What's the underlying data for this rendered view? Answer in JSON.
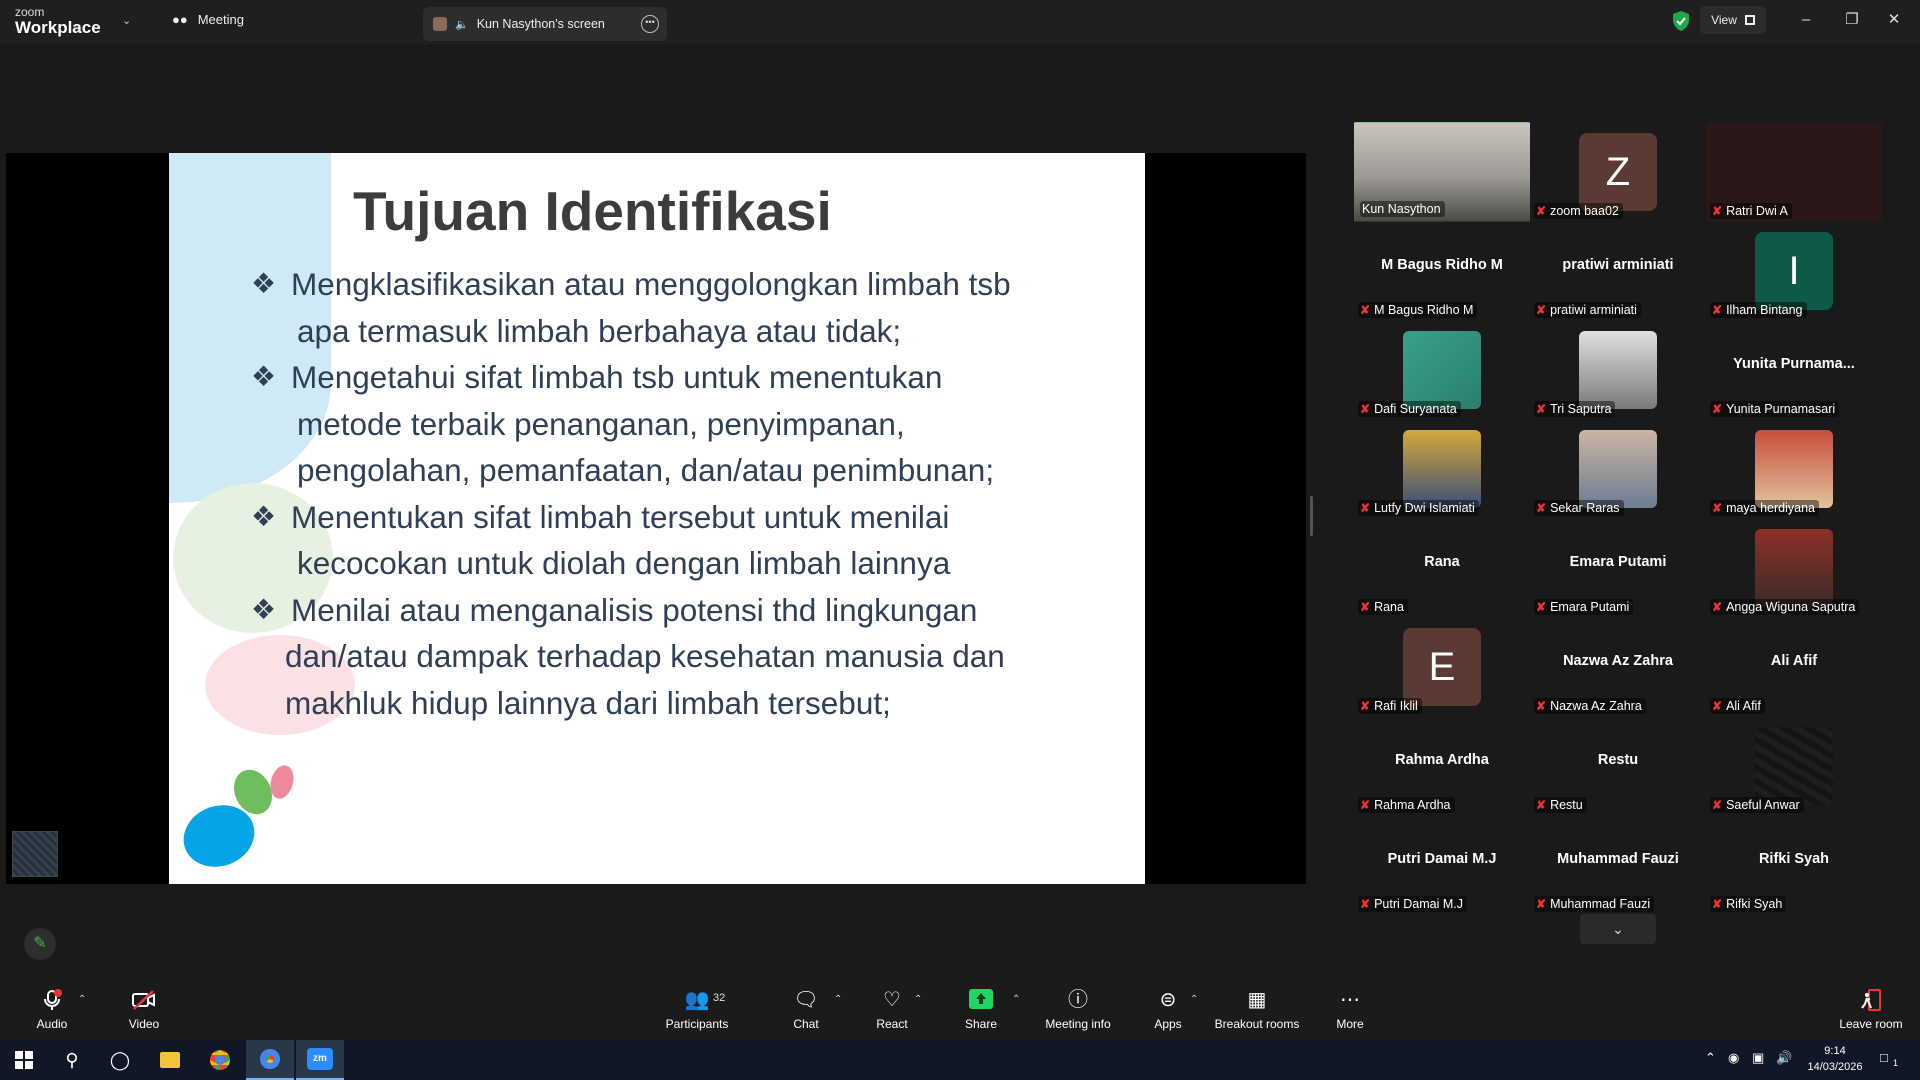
{
  "titlebar": {
    "logo_top": "zoom",
    "logo_bottom": "Workplace",
    "meeting_label": "Meeting",
    "screen_tab_label": "Kun Nasython's screen",
    "view_label": "View"
  },
  "slide": {
    "title": "Tujuan Identifikasi",
    "bullets": [
      {
        "line1": "Mengklasifikasikan atau menggolongkan limbah tsb",
        "line2": "apa termasuk limbah berbahaya atau tidak;",
        "line3": ""
      },
      {
        "line1": "Mengetahui sifat limbah tsb untuk menentukan",
        "line2": "metode terbaik penanganan, penyimpanan,",
        "line3": "pengolahan, pemanfaatan, dan/atau penimbunan;"
      },
      {
        "line1": "Menentukan sifat limbah tersebut untuk menilai",
        "line2": "kecocokan untuk diolah dengan limbah lainnya",
        "line3": ""
      },
      {
        "line1": "Menilai atau menganalisis potensi thd lingkungan",
        "line2": "dan/atau dampak terhadap kesehatan manusia dan",
        "line3": "makhluk hidup lainnya dari limbah tersebut;"
      }
    ]
  },
  "participants": [
    {
      "label": "Kun Nasython",
      "center": "",
      "letter": "",
      "kind": "video-room"
    },
    {
      "label": "zoom baa02",
      "center": "",
      "letter": "Z",
      "kind": "letter",
      "color": "#5a3a32"
    },
    {
      "label": "Ratri Dwi A",
      "center": "",
      "letter": "",
      "kind": "video-dark"
    },
    {
      "label": "M Bagus Ridho M",
      "center": "M Bagus Ridho M",
      "letter": "",
      "kind": "name"
    },
    {
      "label": "pratiwi arminiati",
      "center": "pratiwi arminiati",
      "letter": "",
      "kind": "name"
    },
    {
      "label": "Ilham Bintang",
      "center": "",
      "letter": "I",
      "kind": "letter",
      "color": "#0e5a48"
    },
    {
      "label": "Dafi Suryanata",
      "center": "",
      "letter": "",
      "kind": "photo-teal"
    },
    {
      "label": "Tri Saputra",
      "center": "",
      "letter": "",
      "kind": "photo-gray"
    },
    {
      "label": "Yunita Purnamasari",
      "center": "Yunita  Purnama...",
      "letter": "",
      "kind": "name"
    },
    {
      "label": "Lutfy Dwi Islamiati",
      "center": "",
      "letter": "",
      "kind": "photo-yellow"
    },
    {
      "label": "Sekar Raras",
      "center": "",
      "letter": "",
      "kind": "photo-hijab"
    },
    {
      "label": "maya herdiyana",
      "center": "",
      "letter": "",
      "kind": "photo-red"
    },
    {
      "label": "Rana",
      "center": "Rana",
      "letter": "",
      "kind": "name"
    },
    {
      "label": "Emara Putami",
      "center": "Emara Putami",
      "letter": "",
      "kind": "name"
    },
    {
      "label": "Angga Wiguna Saputra",
      "center": "",
      "letter": "",
      "kind": "photo-truck"
    },
    {
      "label": "Rafi Iklil",
      "center": "",
      "letter": "E",
      "kind": "letter",
      "color": "#5a3a32"
    },
    {
      "label": "Nazwa Az Zahra",
      "center": "Nazwa Az Zahra",
      "letter": "",
      "kind": "name"
    },
    {
      "label": "Ali Afif",
      "center": "Ali Afif",
      "letter": "",
      "kind": "name"
    },
    {
      "label": "Rahma Ardha",
      "center": "Rahma Ardha",
      "letter": "",
      "kind": "name"
    },
    {
      "label": "Restu",
      "center": "Restu",
      "letter": "",
      "kind": "name"
    },
    {
      "label": "Saeful Anwar",
      "center": "",
      "letter": "",
      "kind": "photo-dark"
    },
    {
      "label": "Putri Damai M.J",
      "center": "Putri Damai M.J",
      "letter": "",
      "kind": "name"
    },
    {
      "label": "Muhammad Fauzi",
      "center": "Muhammad Fauzi",
      "letter": "",
      "kind": "name"
    },
    {
      "label": "Rifki Syah",
      "center": "Rifki Syah",
      "letter": "",
      "kind": "name"
    }
  ],
  "toolbar": {
    "audio": "Audio",
    "video": "Video",
    "participants": "Participants",
    "participants_count": "32",
    "chat": "Chat",
    "react": "React",
    "share": "Share",
    "meeting_info": "Meeting info",
    "apps": "Apps",
    "breakout": "Breakout rooms",
    "more": "More",
    "leave": "Leave room"
  },
  "taskbar": {
    "time": "9:14",
    "date": "14/03/2026",
    "notif_count": "1"
  },
  "colors": {
    "accent_green": "#34c759",
    "mute_red": "#e33333",
    "share_green": "#1ed760"
  }
}
